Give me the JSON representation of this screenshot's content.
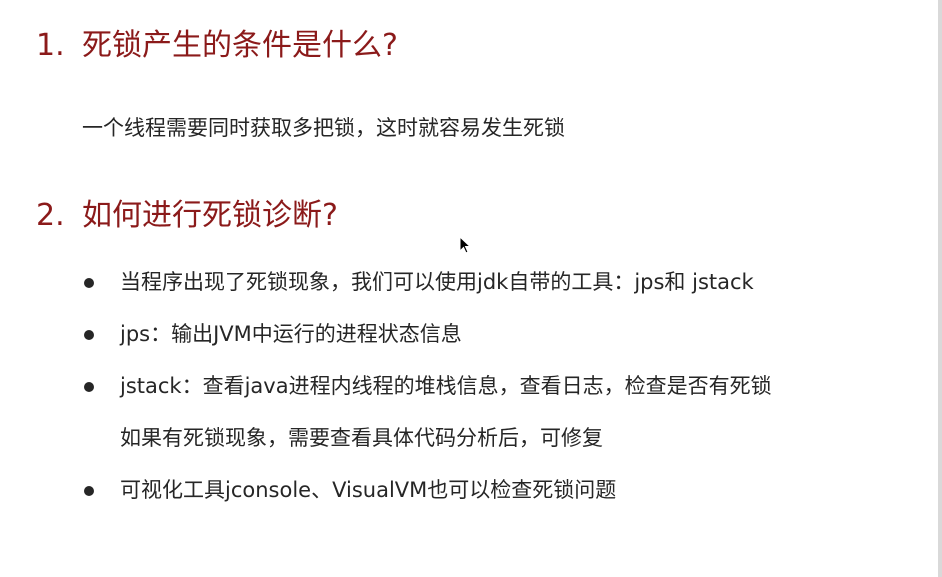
{
  "sections": [
    {
      "number": "1.",
      "title": "死锁产生的条件是什么?",
      "paragraph": "一个线程需要同时获取多把锁，这时就容易发生死锁"
    },
    {
      "number": "2.",
      "title": "如何进行死锁诊断?",
      "bullets": [
        {
          "text": "当程序出现了死锁现象，我们可以使用jdk自带的工具：jps和 jstack"
        },
        {
          "text": "jps：输出JVM中运行的进程状态信息"
        },
        {
          "text": "jstack：查看java进程内线程的堆栈信息，查看日志，检查是否有死锁",
          "continuation": "如果有死锁现象，需要查看具体代码分析后，可修复"
        },
        {
          "text": "可视化工具jconsole、VisualVM也可以检查死锁问题"
        }
      ]
    }
  ],
  "colors": {
    "heading": "#8b1a1a",
    "body_text": "#262626",
    "background": "#ffffff"
  },
  "icons": {
    "bullet": "filled-circle",
    "cursor": "mouse-pointer-arrow"
  }
}
